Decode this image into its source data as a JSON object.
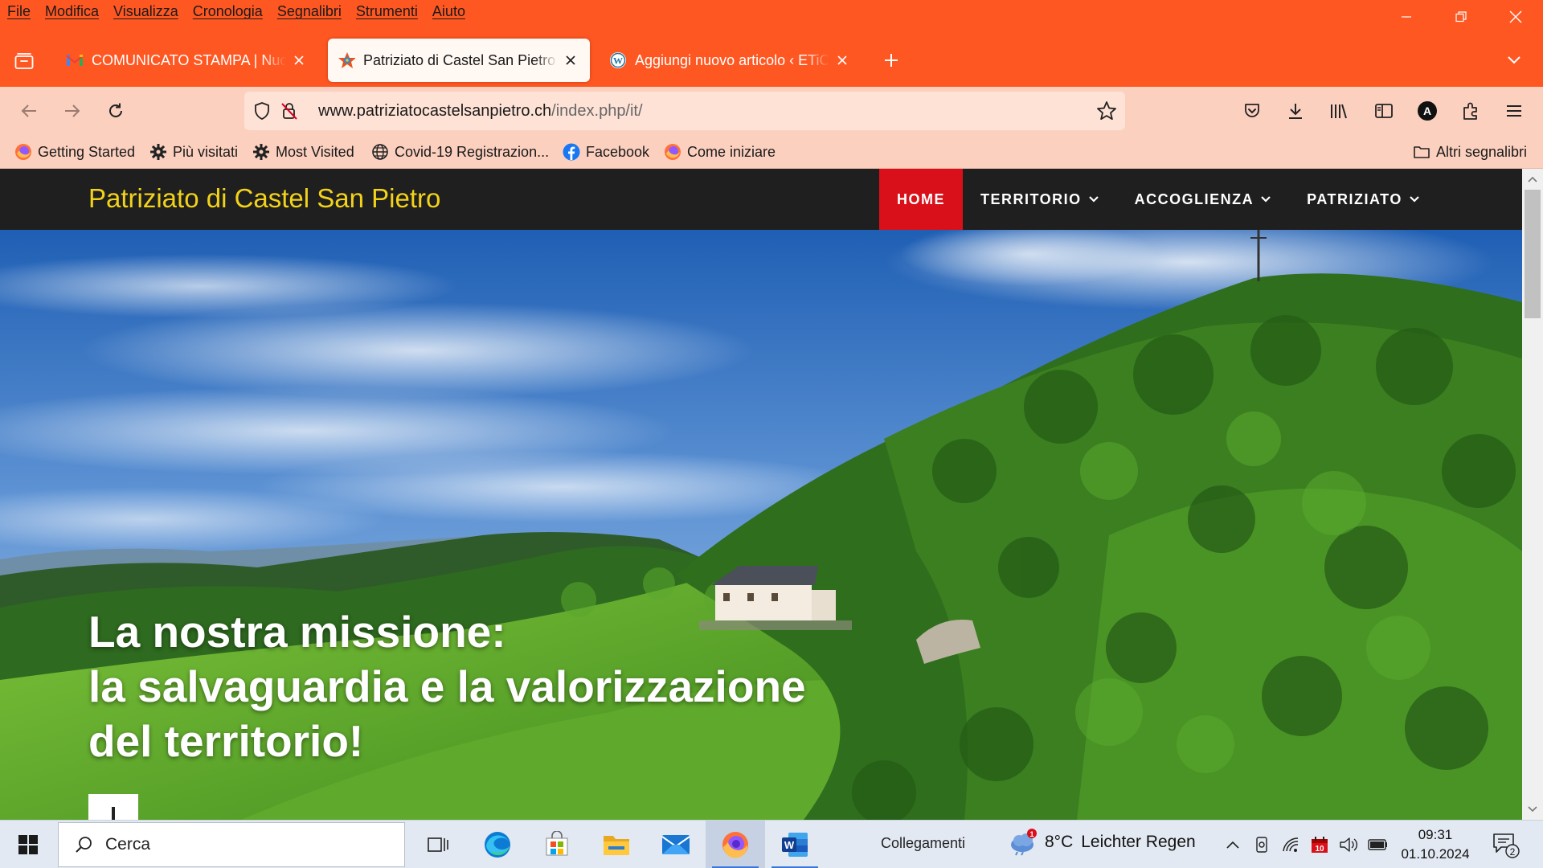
{
  "menubar": {
    "items": [
      "File",
      "Modifica",
      "Visualizza",
      "Cronologia",
      "Segnalibri",
      "Strumenti",
      "Aiuto"
    ]
  },
  "tabs": [
    {
      "title": "COMUNICATO STAMPA | Nuovo",
      "favicon": "gmail-icon",
      "active": false
    },
    {
      "title": "Patriziato di Castel San Pietro - Ho",
      "favicon": "site-favicon",
      "active": true
    },
    {
      "title": "Aggiungi nuovo articolo ‹ ETiCi",
      "favicon": "wordpress-icon",
      "active": false
    }
  ],
  "urlbar": {
    "host": "www.patriziatocastelsanpietro.ch",
    "path": "/index.php/it/"
  },
  "toolbar": {
    "account_initial": "A"
  },
  "bookmarks": {
    "items": [
      {
        "label": "Getting Started",
        "icon": "firefox-icon"
      },
      {
        "label": "Più visitati",
        "icon": "gear-icon"
      },
      {
        "label": "Most Visited",
        "icon": "gear-icon"
      },
      {
        "label": "Covid-19 Registrazion...",
        "icon": "globe-icon"
      },
      {
        "label": "Facebook",
        "icon": "facebook-icon"
      },
      {
        "label": "Come iniziare",
        "icon": "firefox-icon"
      }
    ],
    "other": "Altri segnalibri"
  },
  "site": {
    "title": "Patriziato di Castel San Pietro",
    "nav": [
      {
        "label": "HOME",
        "active": true,
        "dropdown": false
      },
      {
        "label": "TERRITORIO",
        "active": false,
        "dropdown": true
      },
      {
        "label": "ACCOGLIENZA",
        "active": false,
        "dropdown": true
      },
      {
        "label": "PATRIZIATO",
        "active": false,
        "dropdown": true
      }
    ],
    "hero": {
      "line1": "La nostra missione:",
      "line2": "la salvaguardia e la valorizzazione",
      "line3": "del territorio!"
    }
  },
  "taskbar": {
    "search_placeholder": "Cerca",
    "links_label": "Collegamenti",
    "weather": {
      "temp": "8°C",
      "desc": "Leichter Regen",
      "badge": "1"
    },
    "calendar_badge": "10",
    "time": "09:31",
    "date": "01.10.2024",
    "notifications": "2"
  },
  "colors": {
    "browser_accent": "#ff5722",
    "site_title": "#f3d21a",
    "nav_active": "#d9101a"
  }
}
